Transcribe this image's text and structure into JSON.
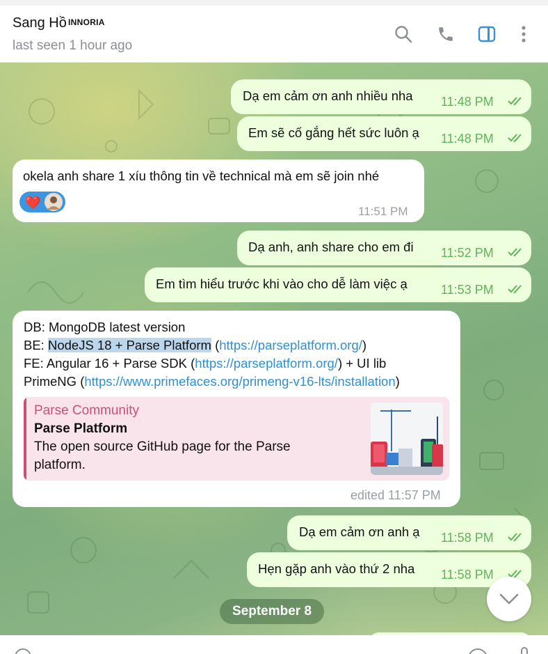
{
  "header": {
    "name": "Sang Hồ",
    "tag": "INNORIA",
    "status": "last seen 1 hour ago",
    "icons": [
      "search-icon",
      "phone-icon",
      "sidebar-panel-icon",
      "more-vertical-icon"
    ],
    "accent_color": "#3a8fd8"
  },
  "messages": [
    {
      "dir": "out",
      "text": "Dạ em cảm ơn anh nhiều nha",
      "time": "11:48 PM"
    },
    {
      "dir": "out",
      "text": "Em sẽ cố gắng hết sức luôn ạ",
      "time": "11:48 PM"
    },
    {
      "dir": "in",
      "text": "okela anh share 1 xíu thông tin về technical mà em sẽ join nhé",
      "time": "11:51 PM",
      "reaction": "❤️"
    },
    {
      "dir": "out",
      "text": "Dạ anh, anh share cho em đi",
      "time": "11:52 PM"
    },
    {
      "dir": "out",
      "text": "Em tìm hiểu trước khi vào cho dễ làm việc ạ",
      "time": "11:53 PM"
    },
    {
      "dir": "out",
      "text": "Dạ em cảm ơn anh ạ",
      "time": "11:58 PM"
    },
    {
      "dir": "out",
      "text": "Hẹn gặp anh vào thứ 2 nha",
      "time": "11:58 PM"
    }
  ],
  "long_message": {
    "db": "DB: MongoDB latest version",
    "be_prefix": "BE: ",
    "be_highlight": "NodeJS 18 + Parse Platform",
    "be_open": " (",
    "be_link": "https://parseplatform.org/",
    "be_close": ")",
    "fe_prefix": "FE: Angular 16 + Parse SDK (",
    "fe_link": "https://parseplatform.org/",
    "fe_suffix": ") + UI lib",
    "primeng_prefix": "PrimeNG (",
    "primeng_link": "https://www.primefaces.org/primeng-v16-lts/installation",
    "primeng_suffix": ")",
    "preview": {
      "site": "Parse Community",
      "title": "Parse Platform",
      "description": "The open source GitHub page for the Parse platform."
    },
    "time": "edited 11:57 PM"
  },
  "date_separator": "September 8",
  "colors": {
    "outgoing_bubble": "#eeffde",
    "incoming_bubble": "#ffffff",
    "time_outgoing": "#5fb35a",
    "link": "#2f8fd1",
    "preview_accent": "#cc4f7a"
  }
}
